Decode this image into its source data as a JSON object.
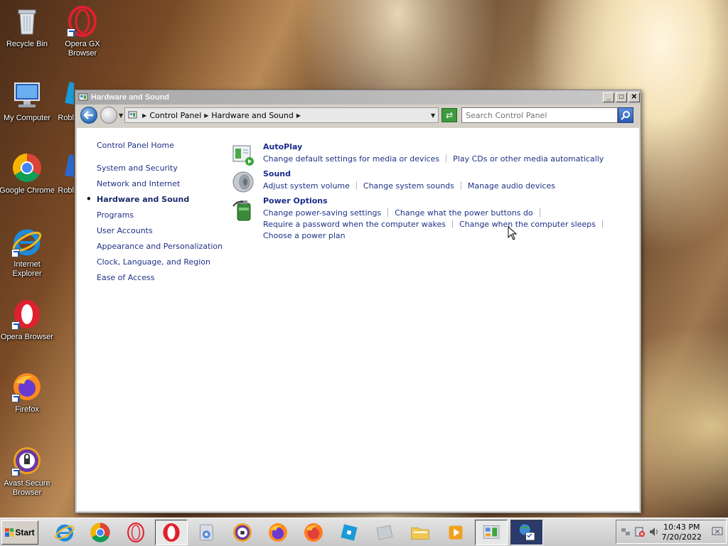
{
  "desktop": {
    "icons": [
      {
        "label": "Recycle Bin"
      },
      {
        "label": "Opera GX\nBrowser"
      },
      {
        "label": "My Computer"
      },
      {
        "label": "Robl"
      },
      {
        "label": "Google Chrome"
      },
      {
        "label": "Robl"
      },
      {
        "label": "Internet\nExplorer"
      },
      {
        "label": "Opera Browser"
      },
      {
        "label": "Firefox"
      },
      {
        "label": "Avast Secure\nBrowser"
      }
    ]
  },
  "window": {
    "title": "Hardware and Sound",
    "breadcrumb": [
      "Control Panel",
      "Hardware and Sound"
    ],
    "search_placeholder": "Search Control Panel",
    "leftnav": {
      "home": "Control Panel Home",
      "items": [
        "System and Security",
        "Network and Internet",
        "Hardware and Sound",
        "Programs",
        "User Accounts",
        "Appearance and Personalization",
        "Clock, Language, and Region",
        "Ease of Access"
      ],
      "active_index": 2
    },
    "sections": [
      {
        "title": "AutoPlay",
        "icon": "autoplay-icon",
        "lines": [
          [
            "Change default settings for media or devices",
            "Play CDs or other media automatically"
          ]
        ]
      },
      {
        "title": "Sound",
        "icon": "speaker-icon",
        "lines": [
          [
            "Adjust system volume",
            "Change system sounds",
            "Manage audio devices"
          ]
        ]
      },
      {
        "title": "Power Options",
        "icon": "battery-plug-icon",
        "lines": [
          [
            "Change power-saving settings",
            "Change what the power buttons do"
          ],
          [
            "Require a password when the computer wakes",
            "Change when the computer sleeps"
          ],
          [
            "Choose a power plan"
          ]
        ]
      }
    ]
  },
  "taskbar": {
    "start_label": "Start",
    "clock_time": "10:43 PM",
    "clock_date": "7/20/2022"
  },
  "colors": {
    "link": "#1e3287",
    "section_title": "#1a2a8c",
    "titlebar": "#a8a8a8"
  }
}
